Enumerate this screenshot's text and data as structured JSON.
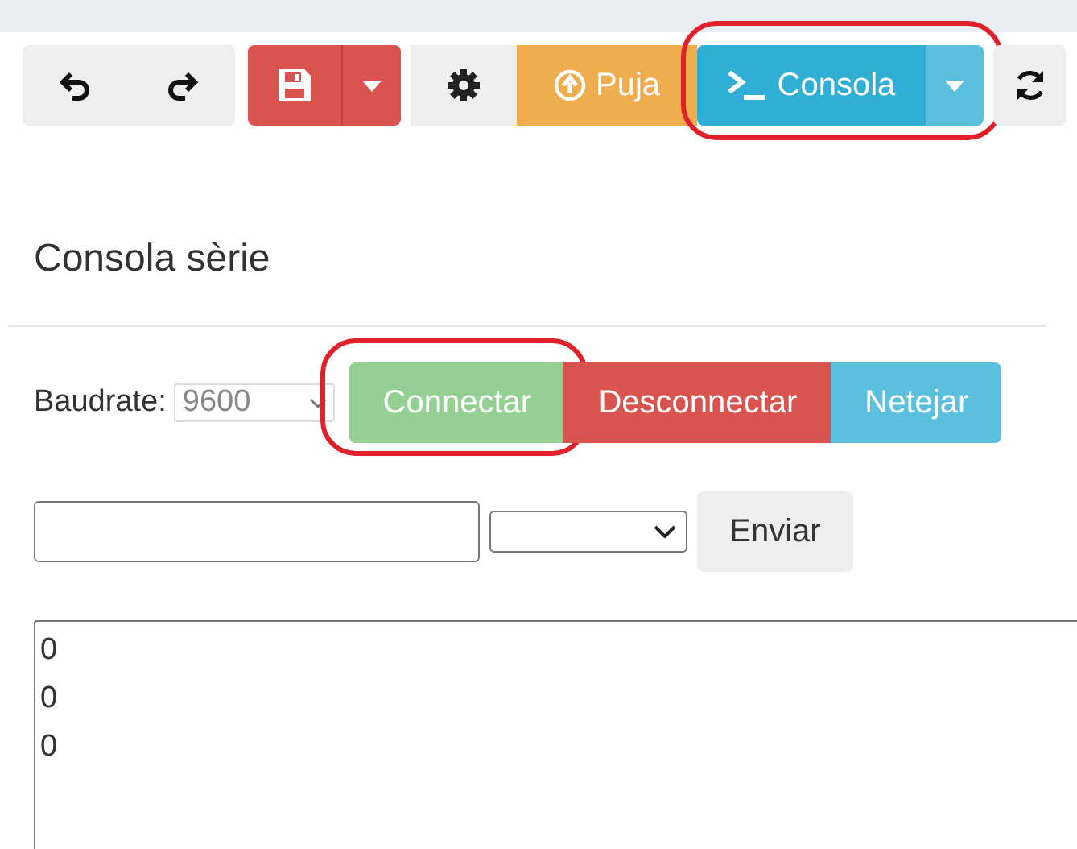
{
  "toolbar": [
    {
      "kind": "undo"
    },
    {
      "kind": "redo"
    },
    {
      "kind": "save"
    },
    {
      "kind": "save-menu"
    },
    {
      "kind": "settings"
    },
    {
      "kind": "upload",
      "label": "Puja"
    },
    {
      "kind": "console",
      "label": "Consola",
      "highlighted": true
    },
    {
      "kind": "console-menu"
    },
    {
      "kind": "refresh"
    }
  ],
  "title": "Consola sèrie",
  "baudrate": {
    "label": "Baudrate:",
    "value": "9600"
  },
  "actions": [
    {
      "kind": "connect",
      "label": "Connectar",
      "disabled": true,
      "highlighted": true
    },
    {
      "kind": "disconnect",
      "label": "Desconnectar",
      "disabled": false,
      "highlighted": false
    },
    {
      "kind": "clear",
      "label": "Netejar",
      "disabled": false,
      "highlighted": false
    }
  ],
  "send_button": "Enviar",
  "output_lines": [
    "0",
    "0",
    "0"
  ]
}
